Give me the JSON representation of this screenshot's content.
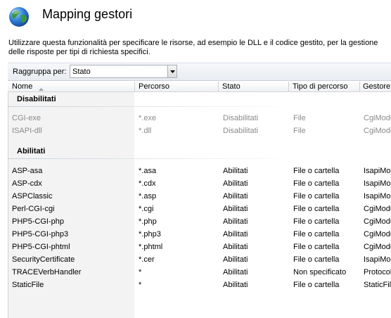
{
  "page": {
    "title": "Mapping gestori",
    "description": "Utilizzare questa funzionalità per specificare le risorse, ad esempio le DLL e il codice gestito, per la gestione delle risposte per tipi di richiesta specifici."
  },
  "toolbar": {
    "group_by_label": "Raggruppa per:",
    "group_by_value": "Stato"
  },
  "columns": [
    "Nome",
    "Percorso",
    "Stato",
    "Tipo di percorso",
    "Gestore"
  ],
  "groups": [
    {
      "name": "Disabilitati",
      "rows": [
        [
          "CGI-exe",
          "*.exe",
          "Disabilitati",
          "File",
          "CgiModule"
        ],
        [
          "ISAPI-dll",
          "*.dll",
          "Disabilitati",
          "File",
          "CgiModule"
        ]
      ]
    },
    {
      "name": "Abilitati",
      "rows": [
        [
          "ASP-asa",
          "*.asa",
          "Abilitati",
          "File o cartella",
          "IsapiModule"
        ],
        [
          "ASP-cdx",
          "*.cdx",
          "Abilitati",
          "File o cartella",
          "IsapiModule"
        ],
        [
          "ASPClassic",
          "*.asp",
          "Abilitati",
          "File o cartella",
          "IsapiModule"
        ],
        [
          "Perl-CGI-cgi",
          "*.cgi",
          "Abilitati",
          "File o cartella",
          "CgiModule"
        ],
        [
          "PHP5-CGI-php",
          "*.php",
          "Abilitati",
          "File o cartella",
          "CgiModule"
        ],
        [
          "PHP5-CGI-php3",
          "*.php3",
          "Abilitati",
          "File o cartella",
          "CgiModule"
        ],
        [
          "PHP5-CGI-phtml",
          "*.phtml",
          "Abilitati",
          "File o cartella",
          "CgiModule"
        ],
        [
          "SecurityCertificate",
          "*.cer",
          "Abilitati",
          "File o cartella",
          "IsapiModule"
        ],
        [
          "TRACEVerbHandler",
          "*",
          "Abilitati",
          "Non specificato",
          "ProtocolSupportModule"
        ],
        [
          "StaticFile",
          "*",
          "Abilitati",
          "File o cartella",
          "StaticFileModule"
        ]
      ]
    }
  ],
  "colors": {
    "disabled_text": "#8a8a8a",
    "sorted_column_bg": "#f3f3f3"
  },
  "icons": {
    "header": "globe-icon",
    "sort": "sort-ascending-icon",
    "dropdown": "chevron-down-icon"
  }
}
